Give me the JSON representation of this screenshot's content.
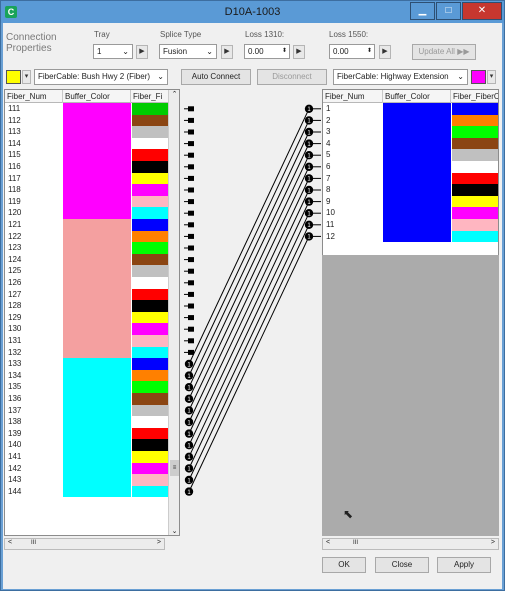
{
  "window": {
    "title": "D10A-1003",
    "app_icon": "C"
  },
  "controls": {
    "connection_properties": "Connection Properties",
    "tray_label": "Tray",
    "tray_value": "1",
    "splice_label": "Splice Type",
    "splice_value": "Fusion",
    "loss1310_label": "Loss 1310:",
    "loss1310_value": "0.00",
    "loss1550_label": "Loss 1550:",
    "loss1550_value": "0.00",
    "update_all": "Update All",
    "left_cable": "FiberCable: Bush Hwy 2 (Fiber)",
    "auto_connect": "Auto Connect",
    "disconnect": "Disconnect",
    "right_cable": "FiberCable: Highway Extension",
    "left_swatch_color": "#ffff00",
    "right_swatch_color": "#ff00ff"
  },
  "left_table": {
    "headers": [
      "Fiber_Num",
      "Buffer_Color",
      "Fiber_Fi"
    ],
    "rows": [
      {
        "num": "111",
        "buffer": "#ff00ff",
        "fiber": "#00cc00"
      },
      {
        "num": "112",
        "buffer": "#ff00ff",
        "fiber": "#8b4513"
      },
      {
        "num": "113",
        "buffer": "#ff00ff",
        "fiber": "#c0c0c0"
      },
      {
        "num": "114",
        "buffer": "#ff00ff",
        "fiber": "#ffffff"
      },
      {
        "num": "115",
        "buffer": "#ff00ff",
        "fiber": "#ff0000"
      },
      {
        "num": "116",
        "buffer": "#ff00ff",
        "fiber": "#000000"
      },
      {
        "num": "117",
        "buffer": "#ff00ff",
        "fiber": "#ffff00"
      },
      {
        "num": "118",
        "buffer": "#ff00ff",
        "fiber": "#ff00ff"
      },
      {
        "num": "119",
        "buffer": "#ff00ff",
        "fiber": "#ffb6c1"
      },
      {
        "num": "120",
        "buffer": "#ff00ff",
        "fiber": "#00ffff"
      },
      {
        "num": "121",
        "buffer": "#f4a0a0",
        "fiber": "#0000ff"
      },
      {
        "num": "122",
        "buffer": "#f4a0a0",
        "fiber": "#ff8000"
      },
      {
        "num": "123",
        "buffer": "#f4a0a0",
        "fiber": "#00ff00"
      },
      {
        "num": "124",
        "buffer": "#f4a0a0",
        "fiber": "#8b4513"
      },
      {
        "num": "125",
        "buffer": "#f4a0a0",
        "fiber": "#c0c0c0"
      },
      {
        "num": "126",
        "buffer": "#f4a0a0",
        "fiber": "#ffffff"
      },
      {
        "num": "127",
        "buffer": "#f4a0a0",
        "fiber": "#ff0000"
      },
      {
        "num": "128",
        "buffer": "#f4a0a0",
        "fiber": "#000000"
      },
      {
        "num": "129",
        "buffer": "#f4a0a0",
        "fiber": "#ffff00"
      },
      {
        "num": "130",
        "buffer": "#f4a0a0",
        "fiber": "#ff00ff"
      },
      {
        "num": "131",
        "buffer": "#f4a0a0",
        "fiber": "#ffb6c1"
      },
      {
        "num": "132",
        "buffer": "#f4a0a0",
        "fiber": "#00ffff"
      },
      {
        "num": "133",
        "buffer": "#00ffff",
        "fiber": "#0000ff"
      },
      {
        "num": "134",
        "buffer": "#00ffff",
        "fiber": "#ff8000"
      },
      {
        "num": "135",
        "buffer": "#00ffff",
        "fiber": "#00ff00"
      },
      {
        "num": "136",
        "buffer": "#00ffff",
        "fiber": "#8b4513"
      },
      {
        "num": "137",
        "buffer": "#00ffff",
        "fiber": "#c0c0c0"
      },
      {
        "num": "138",
        "buffer": "#00ffff",
        "fiber": "#ffffff"
      },
      {
        "num": "139",
        "buffer": "#00ffff",
        "fiber": "#ff0000"
      },
      {
        "num": "140",
        "buffer": "#00ffff",
        "fiber": "#000000"
      },
      {
        "num": "141",
        "buffer": "#00ffff",
        "fiber": "#ffff00"
      },
      {
        "num": "142",
        "buffer": "#00ffff",
        "fiber": "#ff00ff"
      },
      {
        "num": "143",
        "buffer": "#00ffff",
        "fiber": "#ffb6c1"
      },
      {
        "num": "144",
        "buffer": "#00ffff",
        "fiber": "#00ffff"
      }
    ]
  },
  "right_table": {
    "headers": [
      "Fiber_Num",
      "Buffer_Color",
      "Fiber_FiberC"
    ],
    "rows": [
      {
        "num": "1",
        "buffer": "#0000ff",
        "fiber": "#0000ff"
      },
      {
        "num": "2",
        "buffer": "#0000ff",
        "fiber": "#ff8000"
      },
      {
        "num": "3",
        "buffer": "#0000ff",
        "fiber": "#00ff00"
      },
      {
        "num": "4",
        "buffer": "#0000ff",
        "fiber": "#8b4513"
      },
      {
        "num": "5",
        "buffer": "#0000ff",
        "fiber": "#c0c0c0"
      },
      {
        "num": "6",
        "buffer": "#0000ff",
        "fiber": "#ffffff"
      },
      {
        "num": "7",
        "buffer": "#0000ff",
        "fiber": "#ff0000"
      },
      {
        "num": "8",
        "buffer": "#0000ff",
        "fiber": "#000000"
      },
      {
        "num": "9",
        "buffer": "#0000ff",
        "fiber": "#ffff00"
      },
      {
        "num": "10",
        "buffer": "#0000ff",
        "fiber": "#ff00ff"
      },
      {
        "num": "11",
        "buffer": "#0000ff",
        "fiber": "#ffb6c1"
      },
      {
        "num": "12",
        "buffer": "#0000ff",
        "fiber": "#00ffff"
      }
    ]
  },
  "connections": {
    "left_start_index": 22,
    "right_start_index": 0,
    "count": 12,
    "end_label": "1"
  },
  "scroll_symbol": "III",
  "footer": {
    "ok": "OK",
    "close": "Close",
    "apply": "Apply"
  }
}
